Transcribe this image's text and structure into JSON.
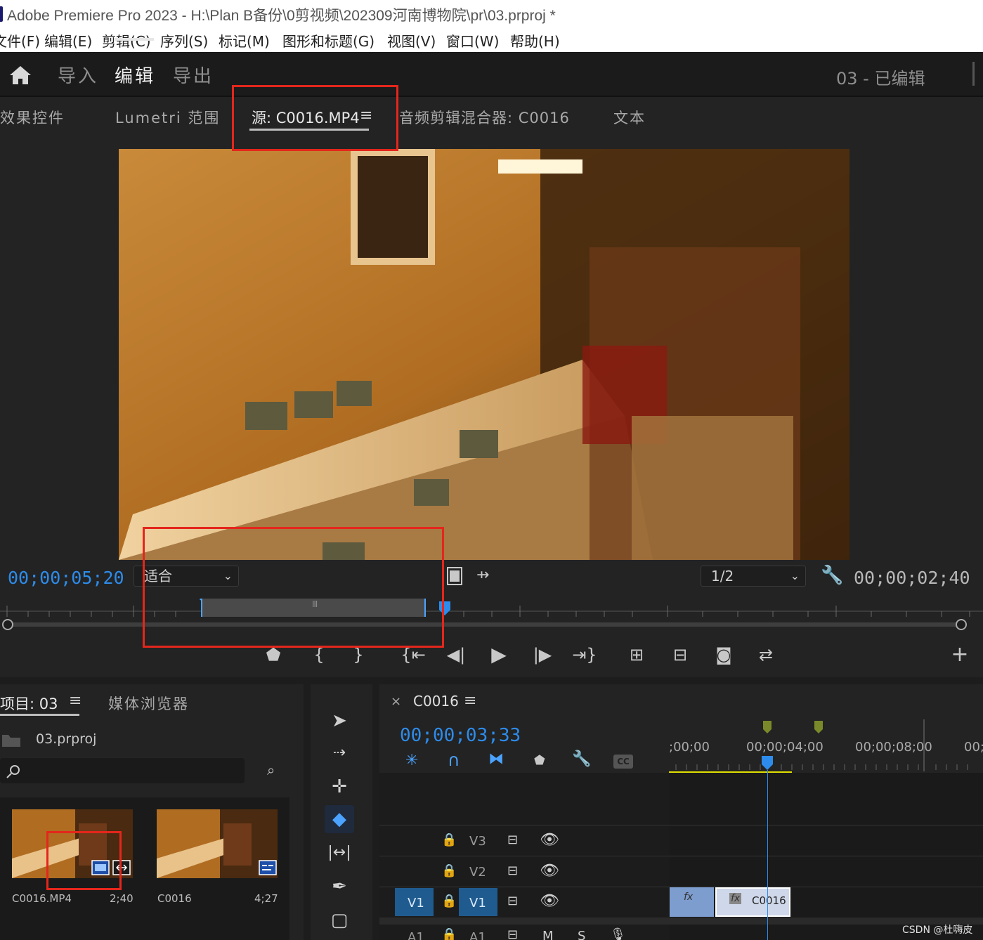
{
  "window": {
    "title": "Adobe Premiere Pro 2023 - H:\\Plan B备份\\0剪视频\\202309河南博物院\\pr\\03.prproj *"
  },
  "menu": [
    "文件(F)",
    "编辑(E)",
    "剪辑(C)",
    "序列(S)",
    "标记(M)",
    "图形和标题(G)",
    "视图(V)",
    "窗口(W)",
    "帮助(H)"
  ],
  "header": {
    "tabs": [
      "导入",
      "编辑",
      "导出"
    ],
    "active_tab": "编辑",
    "project_status": "03 - 已编辑"
  },
  "source_panel": {
    "tabs": [
      "效果控件",
      "Lumetri 范围",
      "源: C0016.MP4",
      "音频剪辑混合器: C0016",
      "文本"
    ],
    "active_tab": "源: C0016.MP4",
    "playhead_timecode": "00;00;05;20",
    "zoom_select": "适合",
    "resolution_select": "1/2",
    "duration_timecode": "00;00;02;40"
  },
  "project_panel": {
    "tabs": [
      "项目: 03",
      "媒体浏览器"
    ],
    "file_name": "03.prproj",
    "search_placeholder": "",
    "items": [
      {
        "name": "C0016.MP4",
        "duration": "2;40"
      },
      {
        "name": "C0016",
        "duration": "4;27"
      }
    ]
  },
  "timeline": {
    "sequence_name": "C0016",
    "timecode": "00;00;03;33",
    "ruler_labels": [
      ";00;00",
      "00;00;04;00",
      "00;00;08;00",
      "00;"
    ],
    "tracks": [
      {
        "name": "V3"
      },
      {
        "name": "V2"
      },
      {
        "name": "V1",
        "source_label": "V1"
      },
      {
        "name": "A1",
        "source_label": "A1"
      }
    ],
    "clip": {
      "name": "C0016"
    }
  },
  "watermark": "CSDN @杜嗨皮",
  "colors": {
    "accent_blue": "#2d8ceb",
    "highlight": "#e4261c",
    "clip": "#8fa8d2"
  }
}
